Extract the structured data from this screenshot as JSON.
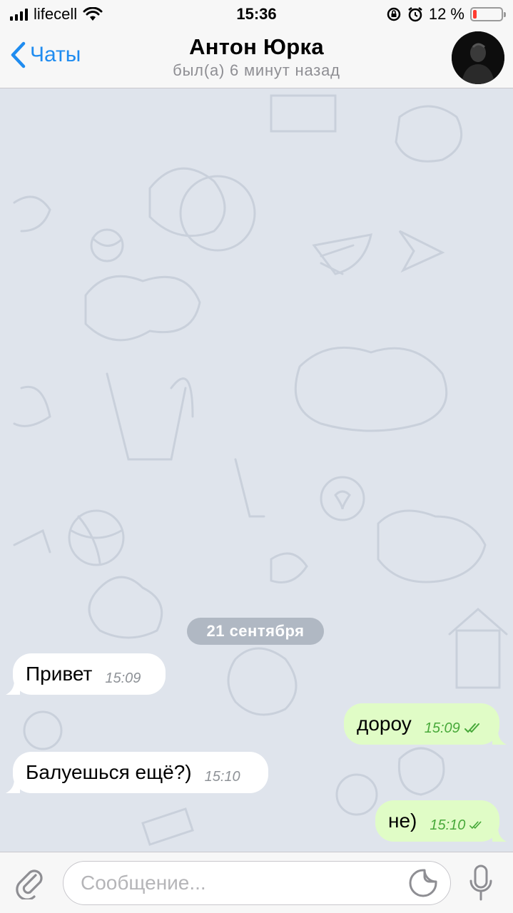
{
  "status_bar": {
    "carrier": "lifecell",
    "time": "15:36",
    "battery_percent": "12 %",
    "battery_level": 0.12
  },
  "header": {
    "back_label": "Чаты",
    "title": "Антон Юрка",
    "status": "был(а) 6 минут назад"
  },
  "chat": {
    "date_separator": "21 сентября",
    "messages": [
      {
        "direction": "in",
        "text": "Привет",
        "time": "15:09"
      },
      {
        "direction": "out",
        "text": "дороу",
        "time": "15:09",
        "read": true
      },
      {
        "direction": "in",
        "text": "Балуешься ещё?)",
        "time": "15:10"
      },
      {
        "direction": "out",
        "text": "не)",
        "time": "15:10",
        "read": true
      }
    ]
  },
  "input": {
    "placeholder": "Сообщение...",
    "value": ""
  },
  "colors": {
    "accent": "#1f8cf0",
    "outgoing_bubble": "#e0fcc6",
    "incoming_bubble": "#ffffff",
    "read_ticks": "#48a93a",
    "battery_low": "#ff3b30"
  },
  "icons": [
    "signal-icon",
    "wifi-icon",
    "rotation-lock-icon",
    "alarm-icon",
    "battery-icon",
    "back-chevron-icon",
    "paperclip-icon",
    "sticker-icon",
    "microphone-icon",
    "double-check-icon"
  ]
}
